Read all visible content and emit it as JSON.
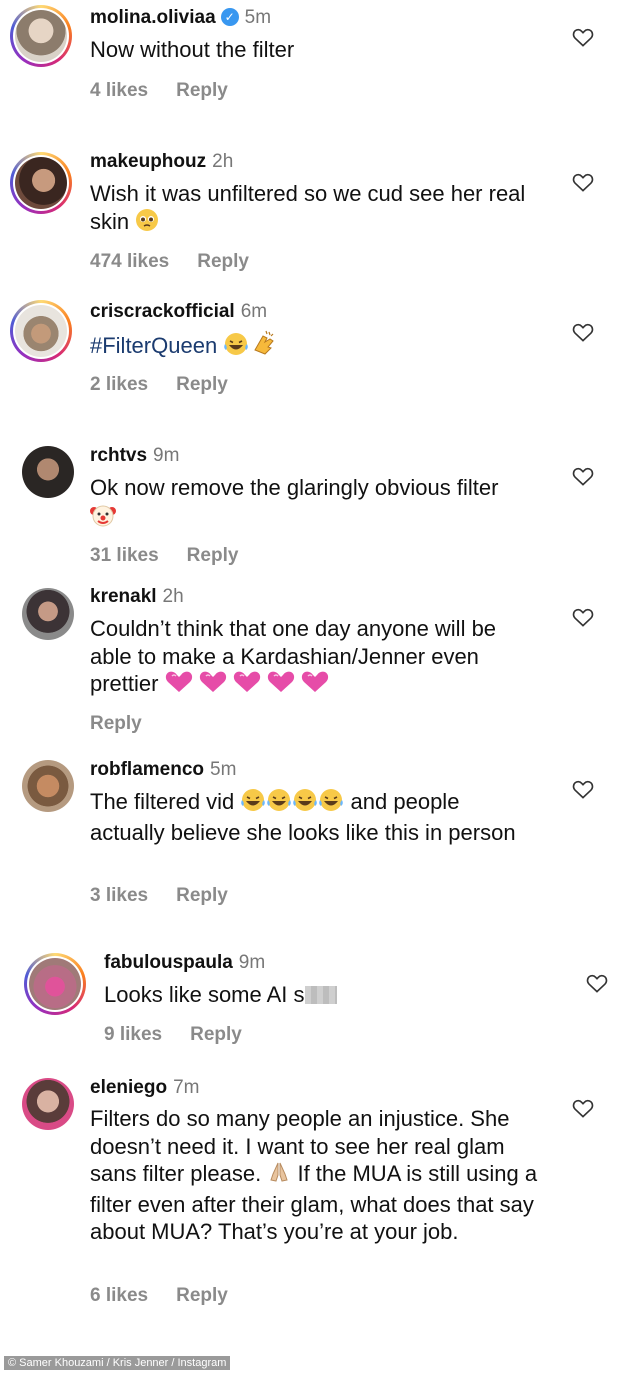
{
  "comments": [
    {
      "username": "molina.oliviaa",
      "time": "5m",
      "verified": true,
      "text": "Now without the filter",
      "likes": "4 likes",
      "reply": "Reply",
      "ring": true,
      "avatar_color": "#cfc4b8",
      "emoji": []
    },
    {
      "username": "makeuphouz",
      "time": "2h",
      "text": "Wish it was unfiltered so we cud see her real skin",
      "likes": "474 likes",
      "reply": "Reply",
      "ring": true,
      "avatar_color": "#8b5a46",
      "emoji": [
        "pleading-face"
      ]
    },
    {
      "username": "criscrackofficial",
      "time": "6m",
      "text": "#FilterQueen",
      "likes": "2 likes",
      "reply": "Reply",
      "ring": true,
      "avatar_color": "#b7a591",
      "emoji": [
        "tears-of-joy",
        "clapping-hands"
      ]
    },
    {
      "username": "rchtvs",
      "time": "9m",
      "text": "Ok now remove the glaringly obvious filter",
      "likes": "31 likes",
      "reply": "Reply",
      "ring": false,
      "avatar_color": "#3d3a36",
      "emoji": [
        "clown-face"
      ]
    },
    {
      "username": "krenakl",
      "time": "2h",
      "text": "Couldn’t think that one day anyone will be able to make a Kardashian/Jenner even prettier",
      "likes": "",
      "reply": "Reply",
      "ring": false,
      "avatar_color": "#4a4548",
      "emoji": [
        "pink-heart",
        "pink-heart",
        "pink-heart",
        "pink-heart",
        "pink-heart"
      ]
    },
    {
      "username": "robflamenco",
      "time": "5m",
      "text_before": "The filtered vid",
      "text_after": "and people actually believe she looks like this in person",
      "likes": "3 likes",
      "reply": "Reply",
      "ring": false,
      "avatar_color": "#9a6a4a",
      "emoji": [
        "tears-of-joy",
        "tears-of-joy",
        "tears-of-joy",
        "tears-of-joy"
      ]
    },
    {
      "username": "fabulouspaula",
      "time": "9m",
      "text": "Looks like some AI s",
      "likes": "9 likes",
      "reply": "Reply",
      "ring": true,
      "avatar_color": "#b54a7a",
      "emoji": []
    },
    {
      "username": "eleniego",
      "time": "7m",
      "text_before": "Filters do so many people an injustice. She doesn’t need it. I want to see her real glam sans filter please.",
      "text_after": "If the MUA is still using a filter even after their glam, what does that say about MUA? That’s you’re at your job.",
      "likes": "6 likes",
      "reply": "Reply",
      "ring": false,
      "avatar_color": "#6a4c52",
      "emoji": [
        "folded-hands"
      ]
    }
  ],
  "icons": {
    "like": "heart-outline-icon",
    "verified": "verified-badge-icon"
  },
  "credit": "© Samer Khouzami / Kris Jenner / Instagram"
}
